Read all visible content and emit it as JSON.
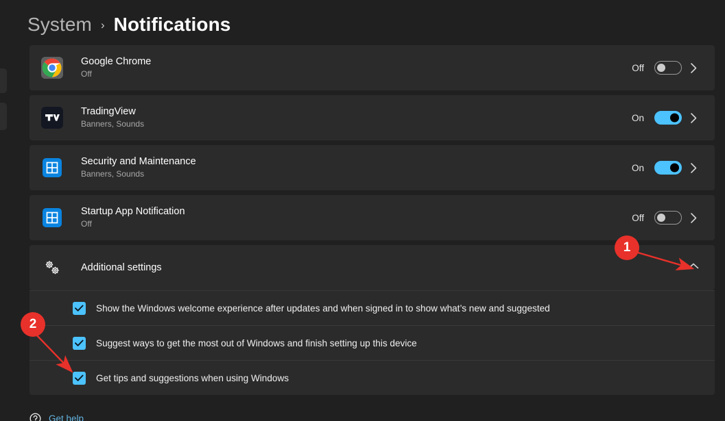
{
  "header": {
    "parent": "System",
    "separator": "›",
    "current": "Notifications"
  },
  "app_rows": [
    {
      "name": "Google Chrome",
      "subtitle": "Off",
      "state": "Off",
      "toggle_on": false,
      "icon": "chrome-icon",
      "chevron": "chevron-right-icon"
    },
    {
      "name": "TradingView",
      "subtitle": "Banners, Sounds",
      "state": "On",
      "toggle_on": true,
      "icon": "tradingview-icon",
      "chevron": "chevron-right-icon"
    },
    {
      "name": "Security and Maintenance",
      "subtitle": "Banners, Sounds",
      "state": "On",
      "toggle_on": true,
      "icon": "windows-security-icon",
      "chevron": "chevron-right-icon"
    },
    {
      "name": "Startup App Notification",
      "subtitle": "Off",
      "state": "Off",
      "toggle_on": false,
      "icon": "windows-security-icon",
      "chevron": "chevron-right-icon"
    }
  ],
  "additional_settings": {
    "label": "Additional settings",
    "icon": "gears-icon",
    "expanded": true,
    "collapse_icon": "chevron-up-icon"
  },
  "checkboxes": [
    {
      "label": "Show the Windows welcome experience after updates and when signed in to show what’s new and suggested",
      "checked": true
    },
    {
      "label": "Suggest ways to get the most out of Windows and finish setting up this device",
      "checked": true
    },
    {
      "label": "Get tips and suggestions when using Windows",
      "checked": true
    }
  ],
  "footer": {
    "help_label": "Get help",
    "help_icon": "question-mark-icon"
  },
  "annotations": [
    {
      "number": "1",
      "target": "collapse-chevron"
    },
    {
      "number": "2",
      "target": "get-tips-checkbox"
    }
  ],
  "colors": {
    "accent": "#4cc2ff",
    "annotation": "#e8312a",
    "row_background": "#2b2b2b",
    "page_background": "#202020",
    "link": "#62b3e0"
  }
}
